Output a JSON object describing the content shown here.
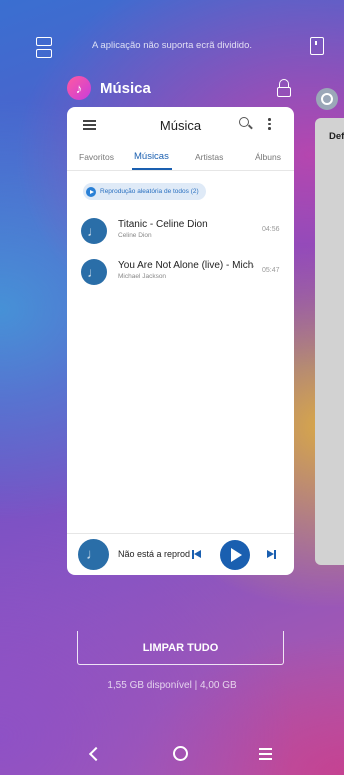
{
  "status": {
    "split_message": "A aplicação não suporta ecrã dividido."
  },
  "app_header": {
    "title": "Música",
    "icon": "music-note-icon"
  },
  "side_card": {
    "label": "Def"
  },
  "card": {
    "toolbar_title": "Música",
    "tabs": [
      {
        "label": "Favoritos",
        "active": false
      },
      {
        "label": "Músicas",
        "active": true
      },
      {
        "label": "Artistas",
        "active": false
      },
      {
        "label": "Álbuns",
        "active": false
      }
    ],
    "shuffle_label": "Reprodução aleatória de todos (2)",
    "songs": [
      {
        "title": "Titanic - Celine Dion",
        "artist": "Celine Dion",
        "duration": "04:56"
      },
      {
        "title": "You Are Not Alone (live) - Michael Jackson",
        "artist": "Michael Jackson",
        "duration": "05:47"
      }
    ],
    "player": {
      "now_playing": "Não está a reproduzir"
    }
  },
  "recents": {
    "clear_label": "LIMPAR TUDO",
    "memory_text": "1,55 GB disponível | 4,00 GB"
  },
  "colors": {
    "accent": "#1a5fb0",
    "shuffle_bg": "#dfeaf7"
  }
}
